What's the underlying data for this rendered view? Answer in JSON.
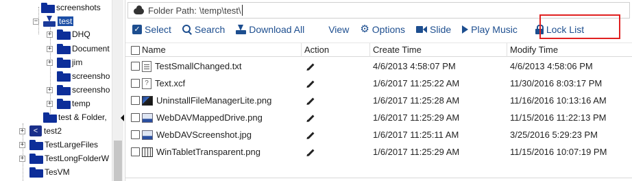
{
  "tree": {
    "items": [
      {
        "label": "screenshots"
      },
      {
        "label": "test",
        "selected": true
      },
      {
        "label": "DHQ"
      },
      {
        "label": "Document"
      },
      {
        "label": "jim"
      },
      {
        "label": "screensho"
      },
      {
        "label": "screensho"
      },
      {
        "label": "temp"
      },
      {
        "label": "test & Folder,"
      },
      {
        "label": "test2"
      },
      {
        "label": "TestLargeFiles"
      },
      {
        "label": "TestLongFolderW"
      },
      {
        "label": "TesVM"
      }
    ]
  },
  "pathbar": {
    "label": "Folder Path:",
    "value": "\\temp\\test\\",
    "icon": "cloud-icon"
  },
  "toolbar": {
    "select": "Select",
    "search": "Search",
    "download_all": "Download All",
    "view": "View",
    "options": "Options",
    "slide": "Slide",
    "play_music": "Play Music",
    "lock_list": "Lock List",
    "highlight_color": "#e02020",
    "accent_color": "#1d4e8f"
  },
  "table": {
    "headers": {
      "name": "Name",
      "action": "Action",
      "create_time": "Create Time",
      "modify_time": "Modify Time"
    },
    "rows": [
      {
        "name": "TestSmallChanged.txt",
        "icon": "text-file-icon",
        "created": "4/6/2013 4:58:07 PM",
        "modified": "4/6/2013 4:58:06 PM"
      },
      {
        "name": "Text.xcf",
        "icon": "unknown-file-icon",
        "created": "1/6/2017 11:25:22 AM",
        "modified": "11/30/2016 8:03:17 PM"
      },
      {
        "name": "UninstallFileManagerLite.png",
        "icon": "image-file-icon",
        "created": "1/6/2017 11:25:28 AM",
        "modified": "11/16/2016 10:13:16 AM"
      },
      {
        "name": "WebDAVMappedDrive.png",
        "icon": "image-file-icon",
        "created": "1/6/2017 11:25:29 AM",
        "modified": "11/15/2016 11:22:13 PM"
      },
      {
        "name": "WebDAVScreenshot.jpg",
        "icon": "image-file-icon",
        "created": "1/6/2017 11:25:11 AM",
        "modified": "3/25/2016 5:29:23 PM"
      },
      {
        "name": "WinTabletTransparent.png",
        "icon": "image-file-icon",
        "created": "1/6/2017 11:25:29 AM",
        "modified": "11/15/2016 10:07:19 PM"
      }
    ]
  }
}
